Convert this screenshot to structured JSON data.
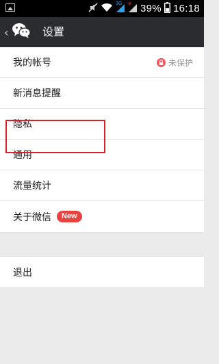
{
  "status_bar": {
    "battery_text": "39%",
    "time": "16:18",
    "network_3g": "3G",
    "signal2_error": "×",
    "icons": [
      "image-notification-icon",
      "mute-icon",
      "wifi-icon",
      "signal-3g-icon",
      "signal-no-service-icon"
    ]
  },
  "header": {
    "back_glyph": "‹",
    "title": "设置",
    "logo_icon": "wechat-logo-icon",
    "background": "#2b2c30"
  },
  "settings": {
    "items": [
      {
        "label": "我的帐号",
        "status": "未保护"
      },
      {
        "label": "新消息提醒"
      },
      {
        "label": "隐私"
      },
      {
        "label": "通用"
      },
      {
        "label": "流量统计"
      },
      {
        "label": "关于微信",
        "badge": "New"
      }
    ],
    "logout_label": "退出"
  },
  "colors": {
    "badge_red": "#e64340",
    "lock_red": "#f2545b",
    "highlight": "#d9202a"
  }
}
